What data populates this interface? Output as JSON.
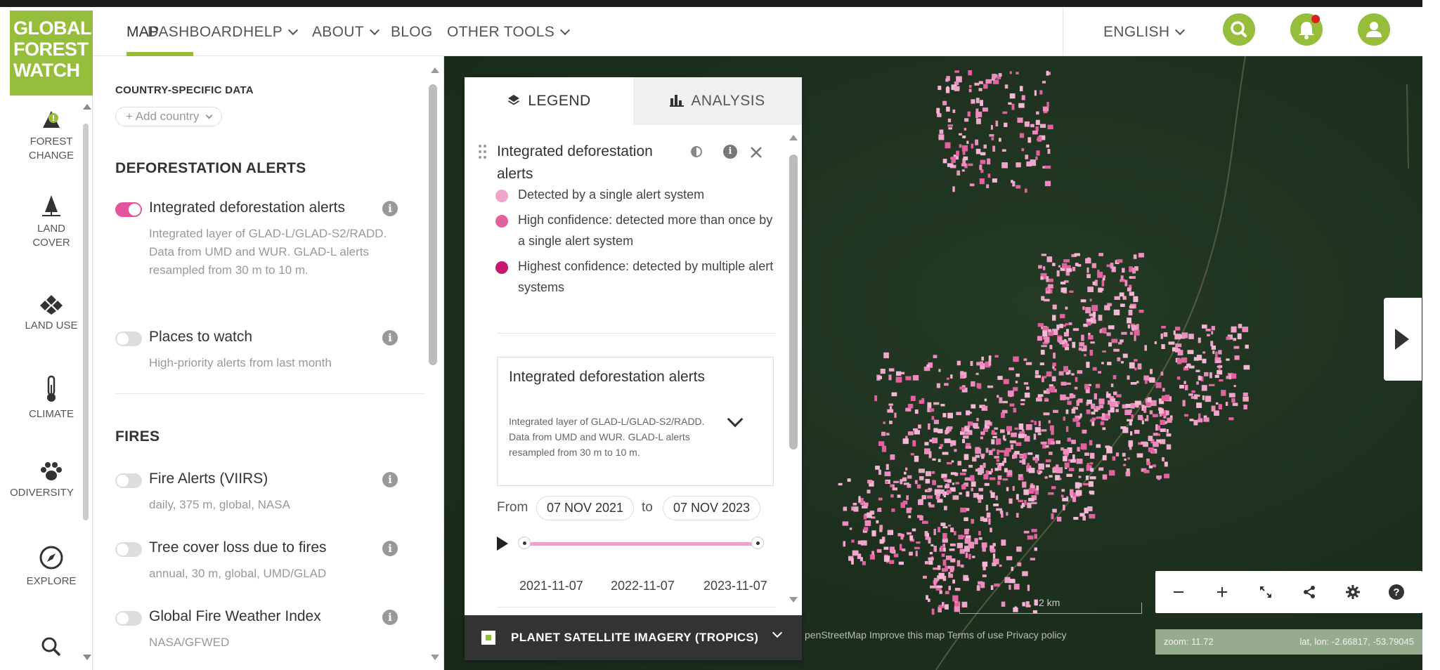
{
  "brand": {
    "logo_lines": [
      "GLOBAL",
      "FOREST",
      "WATCH"
    ],
    "accent_color": "#97bd3d",
    "pink_color": "#e4559d"
  },
  "nav": {
    "items": [
      {
        "label": "MAP",
        "active": true
      },
      {
        "label": "DASHBOARD"
      },
      {
        "label": "HELP",
        "dropdown": true
      },
      {
        "label": "ABOUT",
        "dropdown": true
      },
      {
        "label": "BLOG"
      },
      {
        "label": "OTHER TOOLS",
        "dropdown": true
      }
    ],
    "language": "ENGLISH",
    "icons": [
      "search-icon",
      "bell-icon",
      "user-icon"
    ]
  },
  "iconbar": {
    "items": [
      {
        "label_1": "FOREST",
        "label_2": "CHANGE",
        "icon": "tree-alert-icon"
      },
      {
        "label_1": "LAND",
        "label_2": "COVER",
        "icon": "land-cover-icon"
      },
      {
        "label_1": "LAND USE",
        "label_2": "",
        "icon": "land-use-icon"
      },
      {
        "label_1": "CLIMATE",
        "label_2": "",
        "icon": "thermometer-icon"
      },
      {
        "label_1": "ODIVERSITY",
        "label_2": "",
        "icon": "paw-icon"
      },
      {
        "label_1": "EXPLORE",
        "label_2": "",
        "icon": "compass-icon"
      }
    ]
  },
  "menu": {
    "country_label": "COUNTRY-SPECIFIC DATA",
    "add_country": "+ Add country",
    "sections": {
      "deforestation": "DEFORESTATION ALERTS",
      "fires": "FIRES"
    },
    "layers": [
      {
        "name": "Integrated deforestation alerts",
        "desc": "Integrated layer of GLAD-L/GLAD-S2/RADD. Data from UMD and WUR. GLAD-L alerts resampled from 30 m to 10 m.",
        "on": true
      },
      {
        "name": "Places to watch",
        "desc": "High-priority alerts from last month",
        "on": false
      },
      {
        "name": "Fire Alerts (VIIRS)",
        "desc": "daily, 375 m, global, NASA",
        "on": false
      },
      {
        "name": "Tree cover loss due to fires",
        "desc": "annual, 30 m, global, UMD/GLAD",
        "on": false
      },
      {
        "name": "Global Fire Weather Index",
        "desc": "NASA/GFWED",
        "on": false
      }
    ]
  },
  "legend": {
    "tab_legend": "LEGEND",
    "tab_analysis": "ANALYSIS",
    "layer_title": "Integrated deforestation alerts",
    "items": [
      {
        "label": "Detected by a single alert system",
        "color": "#f0a6cb"
      },
      {
        "label": "High confidence: detected more than once by a single alert system",
        "color": "#e2619f"
      },
      {
        "label": "Highest confidence: detected by multiple alert systems",
        "color": "#c8186e"
      }
    ],
    "card_title": "Integrated deforestation alerts",
    "card_desc": "Integrated layer of GLAD-L/GLAD-S2/RADD. Data from UMD and WUR. GLAD-L alerts resampled from 30 m to 10 m.",
    "from_label": "From",
    "to_label": "to",
    "date_from": "07 NOV 2021",
    "date_to": "07 NOV 2023",
    "ticks": [
      "2021-11-07",
      "2022-11-07",
      "2023-11-07"
    ],
    "basemap": "PLANET SATELLITE IMAGERY (TROPICS)"
  },
  "map": {
    "scale": "2 km",
    "attribution": "penStreetMap  Improve this map  Terms of use  Privacy policy",
    "zoom": "zoom: 11.72",
    "latlon": "lat, lon: -2.66817, -53.79045",
    "tools": [
      "minus-icon",
      "plus-icon",
      "fullscreen-icon",
      "share-icon",
      "settings-icon",
      "help-icon"
    ]
  }
}
